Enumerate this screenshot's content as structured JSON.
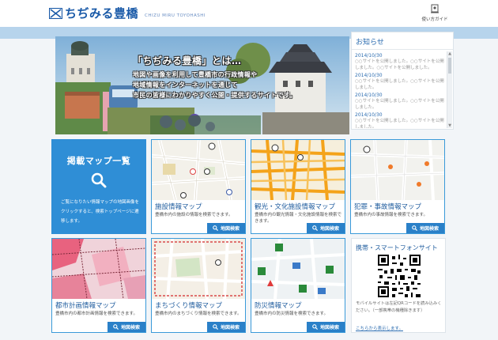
{
  "header": {
    "title": "ちぢみる豊橋",
    "subtitle": "CHIZU MIRU TOYOHASHI",
    "guide_label": "使い方ガイド"
  },
  "hero": {
    "title": "「ちぢみる豊橋」とは…",
    "lines": [
      "地図や画像を利用して豊橋市の行政情報や",
      "地域情報をインターネットを通じて",
      "市民の皆様にわかりやすく公開・提供するサイトです。"
    ]
  },
  "news": {
    "title": "お知らせ",
    "items": [
      {
        "date": "2014/10/30",
        "text": "○○サイトを公開しました。○○サイトを公開しました。○○サイトを公開しました。"
      },
      {
        "date": "2014/10/30",
        "text": "○○サイトを公開しました。○○サイトを公開しました。"
      },
      {
        "date": "2014/10/30",
        "text": "○○サイトを公開しました。○○サイトを公開しました。"
      },
      {
        "date": "2014/10/30",
        "text": "○○サイトを公開しました。○○サイトを公開しました。"
      }
    ]
  },
  "map_list": {
    "title": "掲載マップ一覧",
    "desc": "ご覧になりたい情報マップの地図画像をクリックすると、検索トップページに遷移します。"
  },
  "search_button_label": "地図検索",
  "tiles": [
    {
      "title": "施設情報マップ",
      "desc": "豊橋市内の施設の情報を検索できます。"
    },
    {
      "title": "観光・文化施設情報マップ",
      "desc": "豊橋市内の観光情報・文化施設情報を検索できます。"
    },
    {
      "title": "犯罪・事故情報マップ",
      "desc": "豊橋市内の事故情報を検索できます。"
    },
    {
      "title": "都市計画情報マップ",
      "desc": "豊橋市内の都市計画情報を検索できます。"
    },
    {
      "title": "まちづくり情報マップ",
      "desc": "豊橋市内のまちづくり情報を検索できます。"
    },
    {
      "title": "防災情報マップ",
      "desc": "豊橋市内の防災情報を検索できます。"
    }
  ],
  "mobile": {
    "title": "携帯・スマートフォンサイト",
    "desc": "モバイルサイトは左記QRコードを読み込みください。（一部携帯の機種除きます）",
    "link": "こちらから表示します。"
  },
  "colors": {
    "brand": "#1a5aa8",
    "accent": "#2f8ed6",
    "button": "#2a80c8"
  }
}
